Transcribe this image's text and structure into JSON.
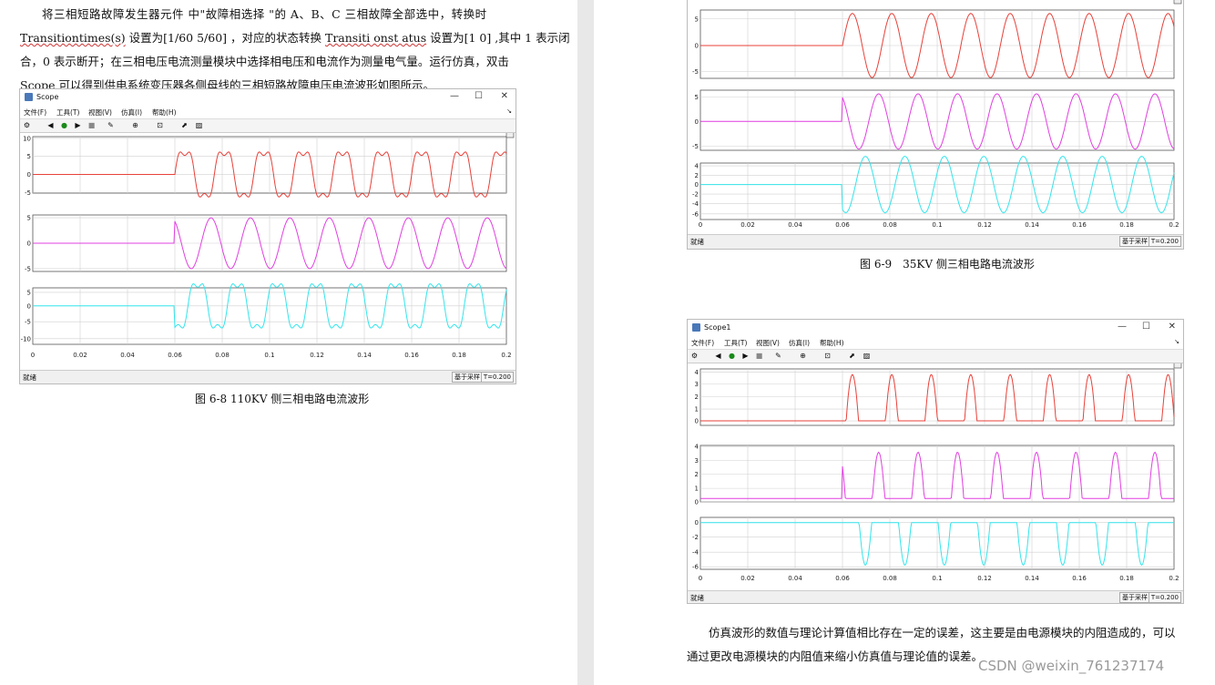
{
  "left_page": {
    "paragraph": [
      "将三相短路故障发生器元件 中\"故障相选择 \"的 A、B、C 三相故障全部选中，转换时",
      "Transitiontimes(s) 设置为[1/60 5/60] ，对应的状态转换 Transiti onst atus 设置为[1 0] ,其中 1 表示闭",
      "合，0 表示断开；在三相电压电流测量模块中选择相电压和电流作为测量电气量。运行仿真，双击",
      "Scope 可以得到供电系统变压器各侧母线的三相短路故障电压电流波形如图所示。"
    ],
    "caption": "图 6-8 110KV 侧三相电路电流波形"
  },
  "right_page": {
    "caption_top": "图 6-9　35KV 侧三相电路电流波形",
    "paragraph": [
      "仿真波形的数值与理论计算值相比存在一定的误差，这主要是由电源模块的内阻造成的，可以",
      "通过更改电源模块的内阻值来缩小仿真值与理论值的误差。"
    ]
  },
  "scopes": {
    "s1": {
      "title": "Scope",
      "menu": [
        "文件(F)",
        "工具(T)",
        "视图(V)",
        "仿真(I)",
        "帮助(H)"
      ],
      "status": "就绪",
      "sample_mode": "基于采样",
      "time": "T=0.200",
      "x_ticks": [
        "0",
        "0.02",
        "0.04",
        "0.06",
        "0.08",
        "0.1",
        "0.12",
        "0.14",
        "0.16",
        "0.18",
        "0.2"
      ],
      "panels": [
        {
          "ticks": [
            "10",
            "5",
            "0",
            "-5"
          ],
          "color": "#e8413a"
        },
        {
          "ticks": [
            "5",
            "0",
            "-5"
          ],
          "color": "#e13fe1"
        },
        {
          "ticks": [
            "5",
            "0",
            "-5",
            "-10"
          ],
          "color": "#33e5ec"
        }
      ]
    },
    "s2": {
      "status": "就绪",
      "sample_mode": "基于采样",
      "time": "T=0.200",
      "x_ticks": [
        "0",
        "0.02",
        "0.04",
        "0.06",
        "0.08",
        "0.1",
        "0.12",
        "0.14",
        "0.16",
        "0.18",
        "0.2"
      ],
      "panels": [
        {
          "ticks": [
            "5",
            "0",
            "-5"
          ],
          "color": "#e8413a"
        },
        {
          "ticks": [
            "5",
            "0",
            "-5"
          ],
          "color": "#e13fe1"
        },
        {
          "ticks": [
            "4",
            "2",
            "0",
            "-2",
            "-4",
            "-6"
          ],
          "color": "#33e5ec"
        }
      ]
    },
    "s3": {
      "title": "Scope1",
      "menu": [
        "文件(F)",
        "工具(T)",
        "视图(V)",
        "仿真(I)",
        "帮助(H)"
      ],
      "status": "就绪",
      "sample_mode": "基于采样",
      "time": "T=0.200",
      "x_ticks": [
        "0",
        "0.02",
        "0.04",
        "0.06",
        "0.08",
        "0.1",
        "0.12",
        "0.14",
        "0.16",
        "0.18",
        "0.2"
      ],
      "panels": [
        {
          "ticks": [
            "4",
            "3",
            "2",
            "1",
            "0"
          ],
          "color": "#e8413a"
        },
        {
          "ticks": [
            "4",
            "3",
            "2",
            "1",
            "0"
          ],
          "color": "#e13fe1"
        },
        {
          "ticks": [
            "0",
            "-2",
            "-4",
            "-6"
          ],
          "color": "#33e5ec"
        }
      ]
    }
  },
  "icons": [
    "scope-app-icon",
    "settings-icon",
    "step-back-icon",
    "run-icon",
    "step-forward-icon",
    "stop-icon",
    "highlight-icon",
    "zoom-icon",
    "fit-icon",
    "cursor-icon",
    "style-icon",
    "undock-icon"
  ],
  "watermark": "CSDN @weixin_761237174"
}
